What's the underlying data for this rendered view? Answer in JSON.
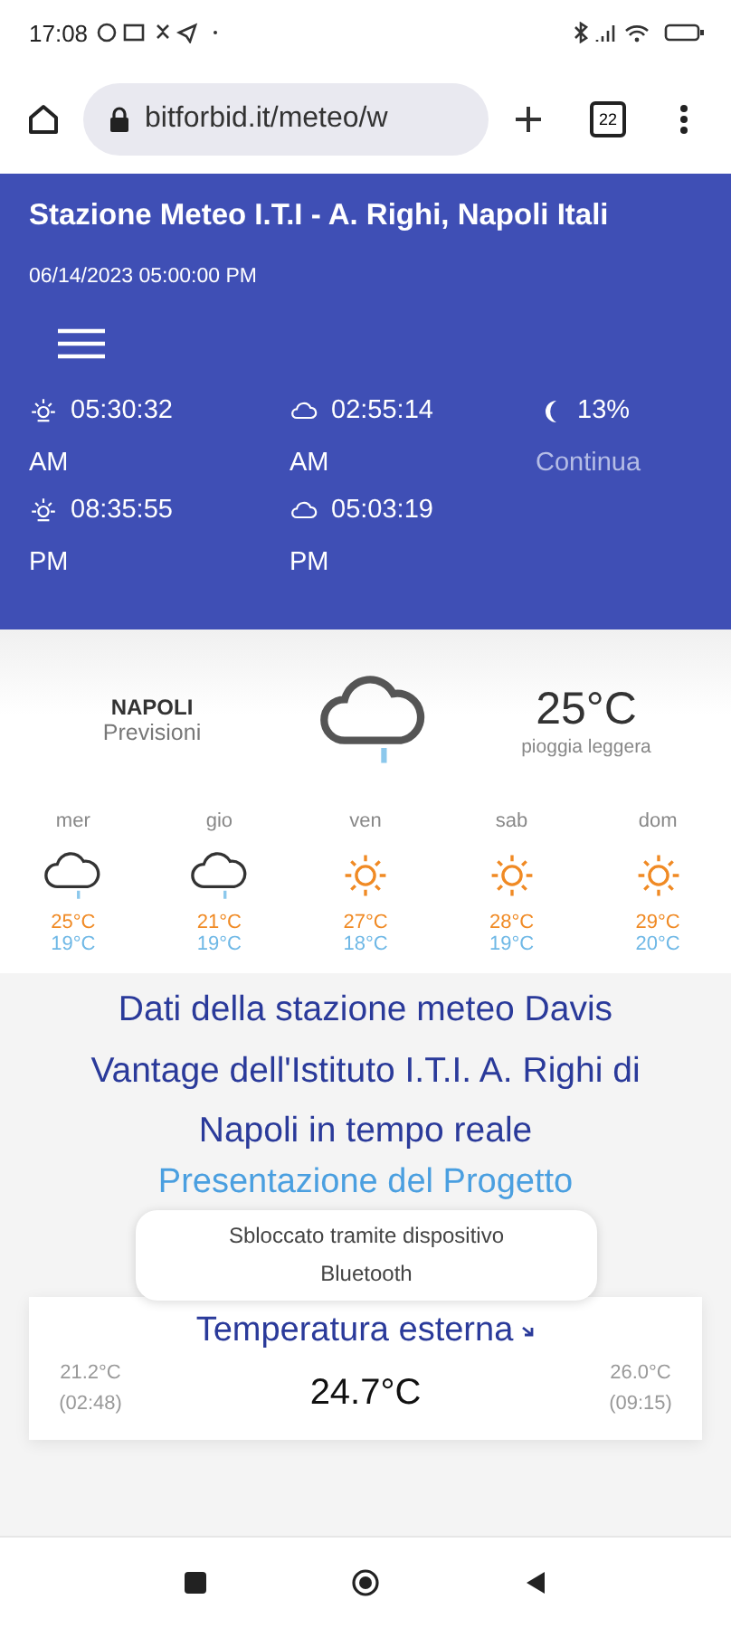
{
  "status_bar": {
    "time": "17:08"
  },
  "browser": {
    "url": "bitforbid.it/meteo/w",
    "tab_count": "22"
  },
  "header": {
    "title": "Stazione Meteo I.T.I - A. Righi, Napoli Itali",
    "datetime": "06/14/2023 05:00:00 PM",
    "astro": [
      {
        "kind": "sunrise",
        "time": "05:30:32",
        "period": "AM"
      },
      {
        "kind": "moonrise",
        "time": "02:55:14",
        "period": "AM"
      },
      {
        "kind": "moon",
        "time": "13%",
        "period": "Continua"
      },
      {
        "kind": "sunset",
        "time": "08:35:55",
        "period": "PM"
      },
      {
        "kind": "moonset",
        "time": "05:03:19",
        "period": "PM"
      }
    ]
  },
  "forecast": {
    "city": "NAPOLI",
    "subtitle": "Previsioni",
    "kind": "rain",
    "temperature": "25°C",
    "condition": "pioggia leggera",
    "days": [
      {
        "day": "mer",
        "kind": "rain",
        "high": "25°C",
        "low": "19°C"
      },
      {
        "day": "gio",
        "kind": "rain",
        "high": "21°C",
        "low": "19°C"
      },
      {
        "day": "ven",
        "kind": "sun",
        "high": "27°C",
        "low": "18°C"
      },
      {
        "day": "sab",
        "kind": "sun",
        "high": "28°C",
        "low": "19°C"
      },
      {
        "day": "dom",
        "kind": "sun",
        "high": "29°C",
        "low": "20°C"
      }
    ]
  },
  "description": "Dati della stazione meteo Davis Vantage dell'Istituto I.T.I. A. Righi di Napoli in tempo reale",
  "project_link": "Presentazione del Progetto",
  "toast": "Sbloccato tramite dispositivo Bluetooth",
  "card": {
    "title": "Temperatura esterna",
    "min": "21.2°C",
    "min_time": "(02:48)",
    "current": "24.7°C",
    "max": "26.0°C",
    "max_time": "(09:15)"
  }
}
